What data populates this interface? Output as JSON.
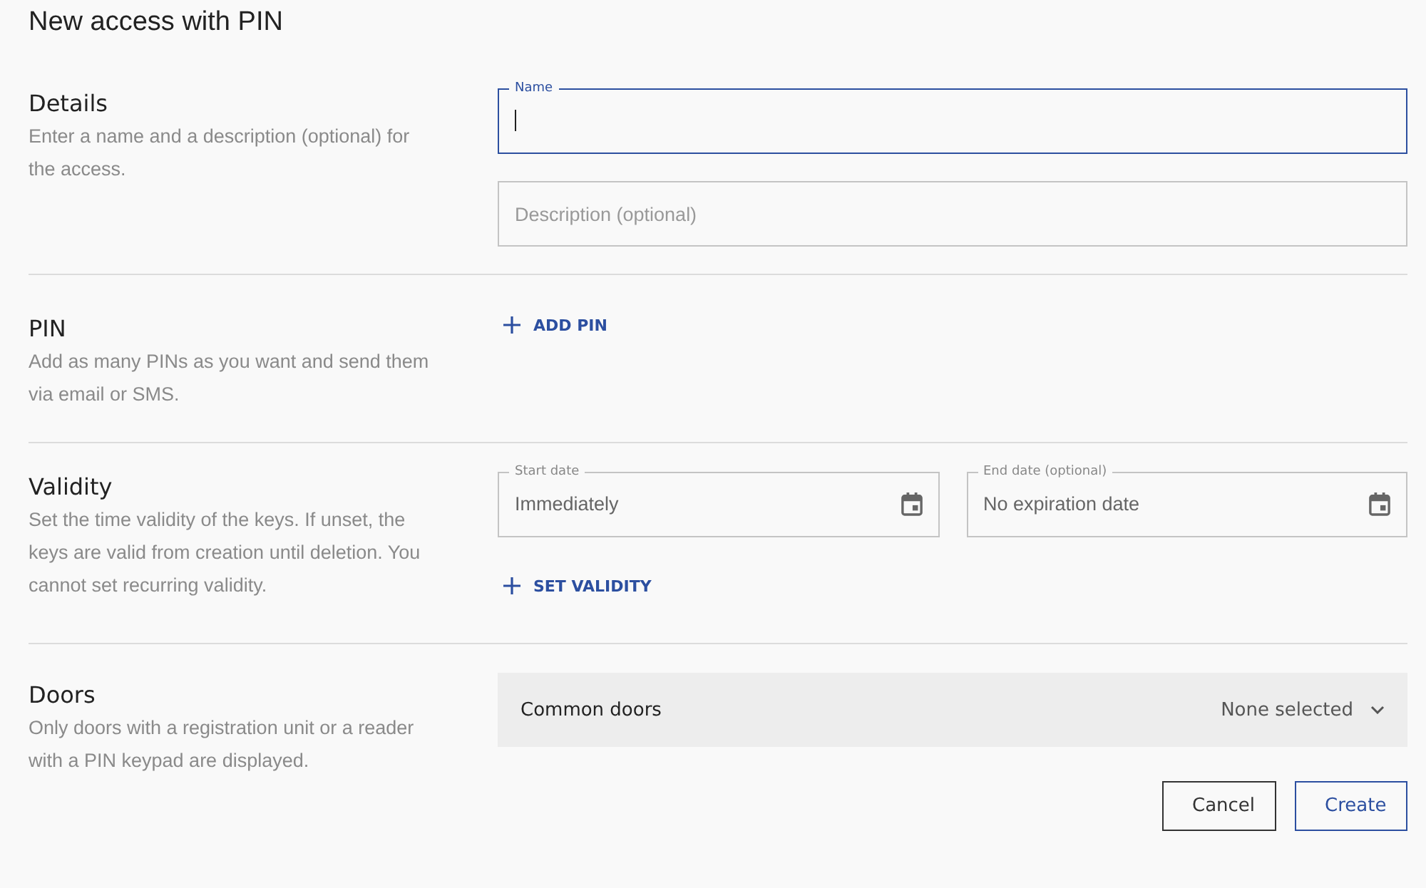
{
  "title": "New access with PIN",
  "details": {
    "heading": "Details",
    "description": "Enter a name and a description (optional) for the access.",
    "name_field": {
      "label": "Name",
      "focused": true
    },
    "description_field": {
      "placeholder": "Description (optional)",
      "focused": false
    }
  },
  "pin": {
    "heading": "PIN",
    "description": "Add as many PINs as you want and send them via email or SMS.",
    "add_button": "ADD PIN"
  },
  "validity": {
    "heading": "Validity",
    "description": "Set the time validity of the keys. If unset, the keys are valid from creation until deletion. You cannot set recurring validity.",
    "start_date": {
      "label": "Start date",
      "value": "Immediately"
    },
    "end_date": {
      "label": "End date (optional)",
      "value": "No expiration date"
    },
    "set_button": "SET VALIDITY"
  },
  "doors": {
    "heading": "Doors",
    "description": "Only doors with a registration unit or a reader with a PIN keypad are displayed.",
    "group": {
      "label": "Common doors",
      "value": "None selected"
    }
  },
  "buttons": [
    {
      "label": "Cancel",
      "kind": "secondary"
    },
    {
      "label": "Create",
      "kind": "primary"
    }
  ]
}
